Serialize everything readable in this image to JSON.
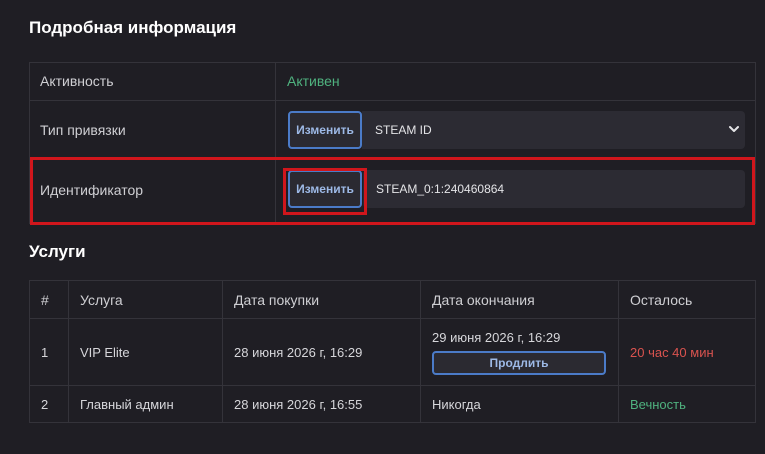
{
  "details": {
    "title": "Подробная информация",
    "activity": {
      "label": "Активность",
      "value": "Активен"
    },
    "binding_type": {
      "label": "Тип привязки",
      "button": "Изменить",
      "value": "STEAM ID"
    },
    "identifier": {
      "label": "Идентификатор",
      "button": "Изменить",
      "value": "STEAM_0:1:240460864"
    }
  },
  "services": {
    "title": "Услуги",
    "headers": [
      "#",
      "Услуга",
      "Дата покупки",
      "Дата окончания",
      "Осталось"
    ],
    "rows": [
      {
        "num": "1",
        "service": "VIP Elite",
        "purchase": "28 июня 2026 г, 16:29",
        "end": "29 июня 2026 г, 16:29",
        "renew": "Продлить",
        "remaining": "20 час 40 мин"
      },
      {
        "num": "2",
        "service": "Главный админ",
        "purchase": "28 июня 2026 г, 16:55",
        "end": "Никогда",
        "remaining": "Вечность"
      }
    ]
  },
  "colors": {
    "background": "#1f1e24",
    "active_green": "#4fb27f",
    "remaining_red": "#d9534f",
    "button_border": "#4b7bc8",
    "highlight_red": "#d0161c"
  },
  "icons": {
    "select_arrow": "chevron-down-icon"
  }
}
